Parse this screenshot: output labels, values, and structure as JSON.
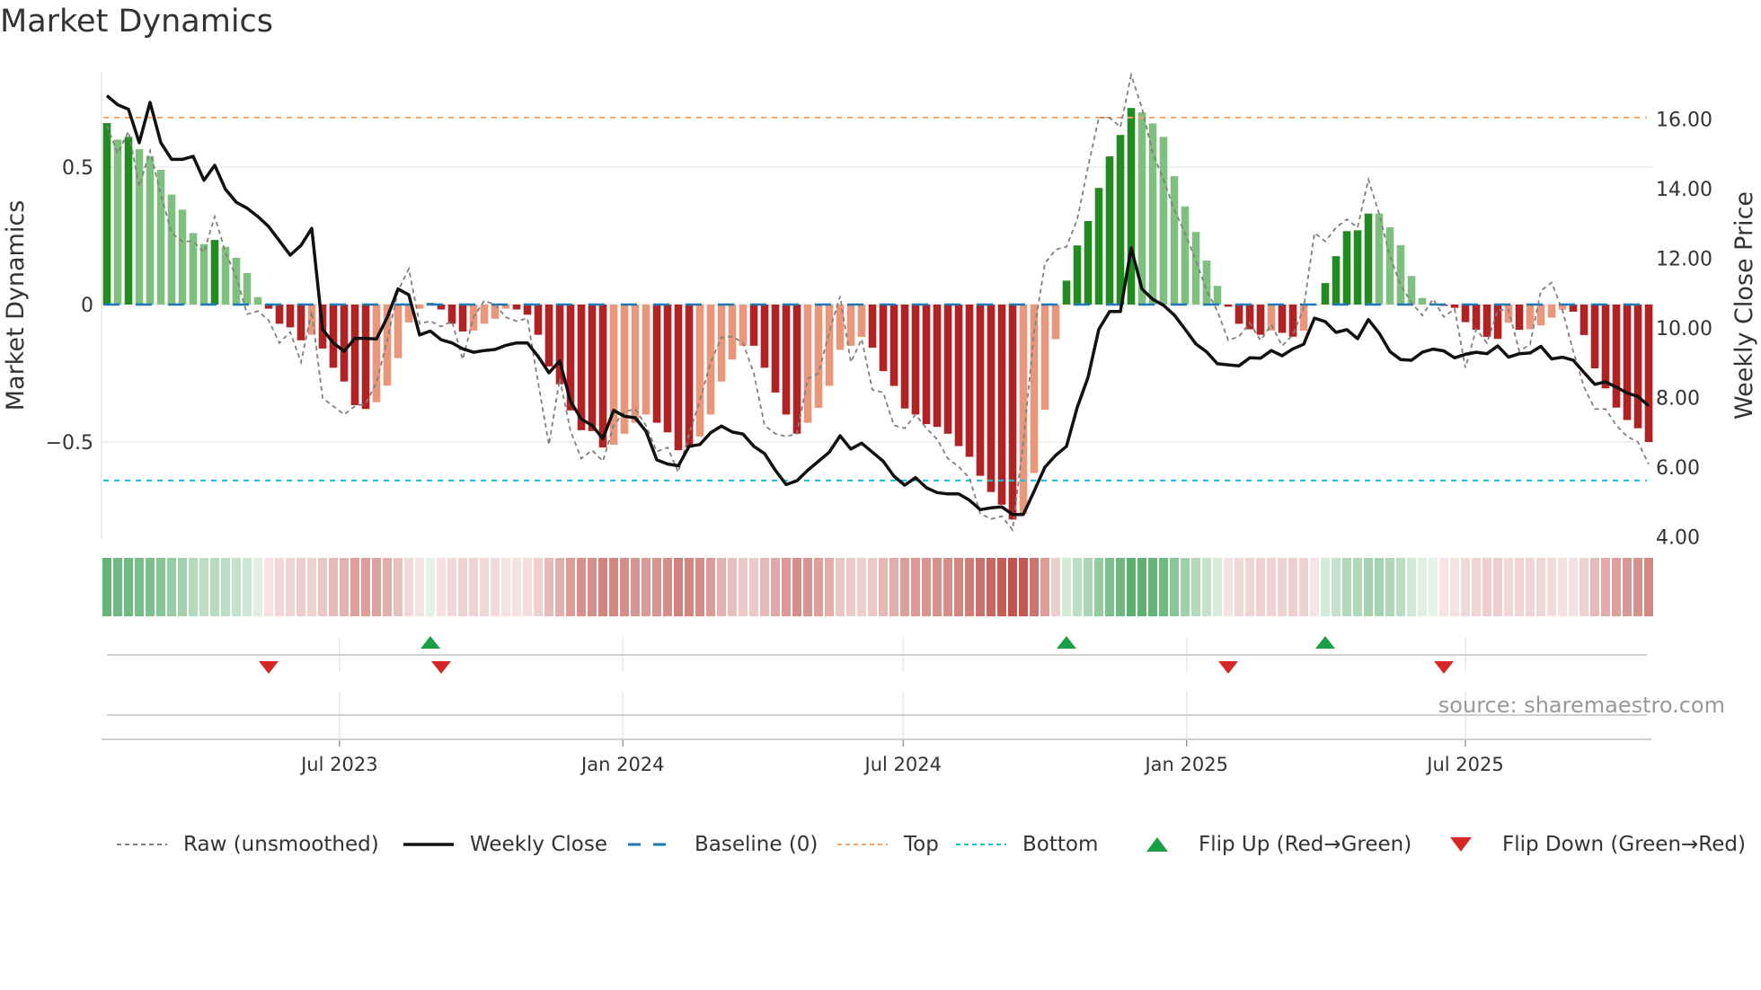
{
  "chart_data": {
    "type": "bar",
    "title": "Market Dynamics",
    "ylabel": "Market Dynamics",
    "y2label": "Weekly Close Price",
    "ylim": [
      -0.84,
      0.86
    ],
    "y2lim": [
      4.0,
      16.7
    ],
    "x_start": "2023-01-31",
    "x_step_days": 7,
    "x_ticks": [
      {
        "date": "2023-07-01",
        "label": "Jul 2023"
      },
      {
        "date": "2024-01-01",
        "label": "Jan 2024"
      },
      {
        "date": "2024-07-01",
        "label": "Jul 2024"
      },
      {
        "date": "2025-01-01",
        "label": "Jan 2025"
      },
      {
        "date": "2025-07-01",
        "label": "Jul 2025"
      }
    ],
    "y_ticks": [
      {
        "value": 0.5,
        "label": "0.5"
      },
      {
        "value": 0,
        "label": "0"
      },
      {
        "value": -0.5,
        "label": "−0.5"
      }
    ],
    "y2_ticks": [
      {
        "value": 16,
        "label": "16.00"
      },
      {
        "value": 14,
        "label": "14.00"
      },
      {
        "value": 12,
        "label": "12.00"
      },
      {
        "value": 10,
        "label": "10.00"
      },
      {
        "value": 8,
        "label": "8.00"
      },
      {
        "value": 6,
        "label": "6.00"
      },
      {
        "value": 4,
        "label": "4.00"
      }
    ],
    "top_level": 0.68,
    "bottom_level": -0.64,
    "baseline": 0,
    "market_dynamics": [
      0.66,
      0.6,
      0.61,
      0.565,
      0.54,
      0.49,
      0.4,
      0.345,
      0.26,
      0.22,
      0.235,
      0.21,
      0.17,
      0.115,
      0.027,
      -0.015,
      -0.07,
      -0.083,
      -0.13,
      -0.11,
      -0.16,
      -0.23,
      -0.28,
      -0.366,
      -0.38,
      -0.355,
      -0.295,
      -0.195,
      -0.065,
      -0.015,
      0.006,
      -0.018,
      -0.07,
      -0.098,
      -0.095,
      -0.07,
      -0.052,
      -0.015,
      -0.018,
      -0.037,
      -0.11,
      -0.225,
      -0.29,
      -0.385,
      -0.457,
      -0.46,
      -0.52,
      -0.51,
      -0.47,
      -0.43,
      -0.4,
      -0.43,
      -0.465,
      -0.53,
      -0.52,
      -0.48,
      -0.4,
      -0.28,
      -0.2,
      -0.15,
      -0.15,
      -0.23,
      -0.32,
      -0.4,
      -0.47,
      -0.43,
      -0.376,
      -0.296,
      -0.165,
      -0.15,
      -0.118,
      -0.157,
      -0.242,
      -0.296,
      -0.378,
      -0.4,
      -0.435,
      -0.445,
      -0.47,
      -0.515,
      -0.554,
      -0.623,
      -0.682,
      -0.728,
      -0.782,
      -0.76,
      -0.613,
      -0.383,
      -0.126,
      0.087,
      0.215,
      0.304,
      0.424,
      0.539,
      0.617,
      0.715,
      0.699,
      0.659,
      0.61,
      0.467,
      0.357,
      0.264,
      0.16,
      0.068,
      -0.008,
      -0.07,
      -0.09,
      -0.11,
      -0.095,
      -0.103,
      -0.117,
      -0.095,
      -0.003,
      0.078,
      0.176,
      0.267,
      0.27,
      0.331,
      0.331,
      0.281,
      0.216,
      0.104,
      0.024,
      0.004,
      -0.005,
      -0.012,
      -0.064,
      -0.092,
      -0.118,
      -0.125,
      -0.066,
      -0.092,
      -0.09,
      -0.076,
      -0.048,
      -0.019,
      -0.026,
      -0.111,
      -0.232,
      -0.305,
      -0.375,
      -0.42,
      -0.45,
      -0.5
    ],
    "strengthening": [
      1,
      0,
      1,
      0,
      0,
      0,
      0,
      0,
      0,
      0,
      1,
      0,
      0,
      0,
      0,
      1,
      1,
      1,
      1,
      0,
      1,
      1,
      1,
      1,
      1,
      0,
      0,
      0,
      0,
      0,
      1,
      1,
      1,
      1,
      0,
      0,
      0,
      0,
      1,
      1,
      1,
      1,
      1,
      1,
      1,
      1,
      1,
      0,
      0,
      0,
      0,
      1,
      1,
      1,
      1,
      0,
      0,
      0,
      0,
      0,
      1,
      1,
      1,
      1,
      1,
      0,
      0,
      0,
      0,
      0,
      0,
      1,
      1,
      1,
      1,
      1,
      1,
      1,
      1,
      1,
      1,
      1,
      1,
      1,
      1,
      0,
      0,
      0,
      0,
      1,
      1,
      1,
      1,
      1,
      1,
      1,
      0,
      0,
      0,
      0,
      0,
      0,
      0,
      0,
      1,
      1,
      1,
      1,
      0,
      1,
      1,
      0,
      0,
      1,
      1,
      1,
      1,
      1,
      0,
      0,
      0,
      0,
      0,
      0,
      1,
      1,
      1,
      1,
      1,
      1,
      0,
      1,
      0,
      0,
      0,
      0,
      1,
      1,
      1,
      1,
      1,
      1,
      1,
      1
    ],
    "raw_unsmoothed": [
      0.65,
      0.55,
      0.63,
      0.43,
      0.56,
      0.4,
      0.26,
      0.23,
      0.23,
      0.19,
      0.32,
      0.19,
      0.1,
      -0.035,
      -0.024,
      -0.057,
      -0.14,
      -0.1,
      -0.21,
      -0.024,
      -0.34,
      -0.37,
      -0.4,
      -0.37,
      -0.36,
      -0.285,
      -0.13,
      0.05,
      0.13,
      -0.07,
      -0.06,
      -0.08,
      -0.06,
      -0.2,
      -0.046,
      0.014,
      0.0,
      -0.046,
      -0.06,
      -0.05,
      -0.285,
      -0.51,
      -0.27,
      -0.46,
      -0.56,
      -0.53,
      -0.57,
      -0.44,
      -0.39,
      -0.38,
      -0.44,
      -0.535,
      -0.52,
      -0.61,
      -0.47,
      -0.35,
      -0.21,
      -0.12,
      -0.116,
      -0.14,
      -0.25,
      -0.44,
      -0.47,
      -0.48,
      -0.47,
      -0.27,
      -0.25,
      -0.1,
      0.03,
      -0.21,
      -0.125,
      -0.31,
      -0.32,
      -0.44,
      -0.45,
      -0.4,
      -0.45,
      -0.49,
      -0.56,
      -0.59,
      -0.63,
      -0.76,
      -0.78,
      -0.77,
      -0.82,
      -0.5,
      -0.1,
      0.15,
      0.2,
      0.21,
      0.31,
      0.5,
      0.68,
      0.68,
      0.645,
      0.835,
      0.715,
      0.55,
      0.455,
      0.345,
      0.26,
      0.16,
      0.05,
      -0.024,
      -0.13,
      -0.116,
      -0.067,
      -0.13,
      -0.073,
      -0.15,
      -0.11,
      -0.013,
      0.26,
      0.23,
      0.28,
      0.31,
      0.28,
      0.455,
      0.33,
      0.176,
      0.07,
      0.007,
      -0.04,
      0.02,
      -0.045,
      -0.016,
      -0.23,
      -0.09,
      -0.14,
      -0.02,
      -0.02,
      -0.17,
      -0.145,
      0.05,
      0.08,
      -0.02,
      -0.17,
      -0.3,
      -0.38,
      -0.38,
      -0.44,
      -0.48,
      -0.5,
      -0.58
    ],
    "weekly_close": [
      16.67,
      16.41,
      16.28,
      15.32,
      16.48,
      15.32,
      14.84,
      14.84,
      14.93,
      14.24,
      14.67,
      13.98,
      13.61,
      13.44,
      13.2,
      12.91,
      12.5,
      12.09,
      12.37,
      12.86,
      9.96,
      9.57,
      9.33,
      9.7,
      9.7,
      9.68,
      10.3,
      11.12,
      10.95,
      9.8,
      9.91,
      9.66,
      9.57,
      9.4,
      9.3,
      9.35,
      9.38,
      9.5,
      9.57,
      9.57,
      9.18,
      8.71,
      9.05,
      7.89,
      7.38,
      7.2,
      6.82,
      7.63,
      7.46,
      7.42,
      7.03,
      6.21,
      6.09,
      6.04,
      6.6,
      6.65,
      6.99,
      7.18,
      7.01,
      6.95,
      6.6,
      6.39,
      5.91,
      5.5,
      5.61,
      5.91,
      6.17,
      6.43,
      6.9,
      6.52,
      6.69,
      6.43,
      6.17,
      5.74,
      5.48,
      5.7,
      5.41,
      5.27,
      5.23,
      5.23,
      5.05,
      4.78,
      4.83,
      4.86,
      4.64,
      4.64,
      5.31,
      6.0,
      6.34,
      6.6,
      7.72,
      8.58,
      9.96,
      10.47,
      10.47,
      12.3,
      11.12,
      10.82,
      10.65,
      10.37,
      9.96,
      9.54,
      9.31,
      8.97,
      8.94,
      8.91,
      9.14,
      9.13,
      9.35,
      9.2,
      9.4,
      9.53,
      10.28,
      10.18,
      9.87,
      9.95,
      9.69,
      10.24,
      9.85,
      9.32,
      9.09,
      9.07,
      9.3,
      9.39,
      9.34,
      9.14,
      9.24,
      9.3,
      9.26,
      9.48,
      9.16,
      9.26,
      9.28,
      9.47,
      9.11,
      9.16,
      9.07,
      8.72,
      8.38,
      8.45,
      8.3,
      8.13,
      8.03,
      7.76
    ],
    "flips": [
      {
        "index": 15,
        "type": "down"
      },
      {
        "index": 30,
        "type": "up"
      },
      {
        "index": 31,
        "type": "down"
      },
      {
        "index": 89,
        "type": "up"
      },
      {
        "index": 104,
        "type": "down"
      },
      {
        "index": 113,
        "type": "up"
      },
      {
        "index": 124,
        "type": "down"
      }
    ],
    "legend": [
      {
        "key": "raw",
        "label": "Raw (unsmoothed)"
      },
      {
        "key": "close",
        "label": "Weekly Close"
      },
      {
        "key": "baseline",
        "label": "Baseline (0)"
      },
      {
        "key": "top",
        "label": "Top"
      },
      {
        "key": "bottom",
        "label": "Bottom"
      },
      {
        "key": "flip_up",
        "label": "Flip Up (Red→Green)"
      },
      {
        "key": "flip_down",
        "label": "Flip Down (Green→Red)"
      }
    ],
    "legend_position": "bottom",
    "source": "source: sharemaestro.com",
    "colors": {
      "green_strong": "#228b22",
      "green_weak": "#7fbf7f",
      "red_strong": "#b22222",
      "red_weak": "#e9967a",
      "baseline": "#1f77b4",
      "top": "#f4a460",
      "bottom": "#17becf",
      "raw": "#808080",
      "close": "#111111",
      "flip_up": "#1a9e46",
      "flip_down": "#d62728",
      "heat_green": "#4aa860",
      "heat_red": "#c0504a"
    }
  }
}
